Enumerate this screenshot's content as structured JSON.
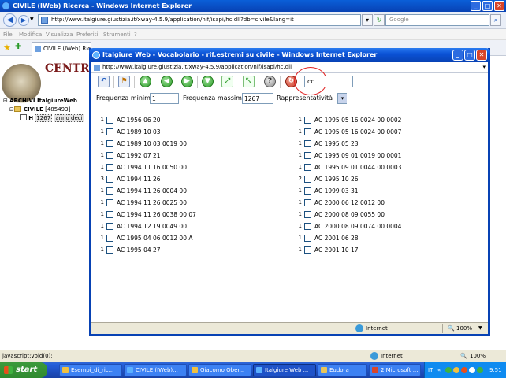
{
  "bg_window": {
    "title": "CIVILE (IWeb) Ricerca - Windows Internet Explorer",
    "url": "http://www.italgiure.giustizia.it/xway-4.5.9/application/nif/isapi/hc.dll?db=civile&lang=it",
    "search_placeholder": "Google",
    "menu": [
      "File",
      "Modifica",
      "Visualizza",
      "Preferiti",
      "Strumenti",
      "?"
    ],
    "tab_label": "CIVILE (IWeb) Ricerca",
    "header_text": "CENTRO",
    "tree": {
      "root": "ARCHIVI ItalgiureWeb",
      "civile": "CIVILE",
      "civile_count": "[485493]",
      "node_prefix": "H",
      "node_count": "1267",
      "node_label": "anno deci"
    },
    "status_left": "javascript:void(0);",
    "status_zone": "Internet",
    "zoom": "100%"
  },
  "popup": {
    "title": "Italgiure Web - Vocabolario - rif.estremi su civile - Windows Internet Explorer",
    "url": "http://www.italgiure.giustizia.it/xway-4.5.9/application/nif/isapi/hc.dll",
    "search_value": "cc",
    "filters": {
      "freq_min_label": "Frequenza minima",
      "freq_min_value": "1",
      "freq_max_label": "Frequenza massima",
      "freq_max_value": "1267",
      "rappr_label": "Rappresentatività"
    },
    "left_list": [
      {
        "count": "1",
        "text": "AC 1956 06 20"
      },
      {
        "count": "1",
        "text": "AC 1989 10 03"
      },
      {
        "count": "1",
        "text": "AC 1989 10 03 0019 00"
      },
      {
        "count": "1",
        "text": "AC 1992 07 21"
      },
      {
        "count": "1",
        "text": "AC 1994 11 16 0050 00"
      },
      {
        "count": "3",
        "text": "AC 1994 11 26"
      },
      {
        "count": "1",
        "text": "AC 1994 11 26 0004 00"
      },
      {
        "count": "1",
        "text": "AC 1994 11 26 0025 00"
      },
      {
        "count": "1",
        "text": "AC 1994 11 26 0038 00 07"
      },
      {
        "count": "1",
        "text": "AC 1994 12 19 0049 00"
      },
      {
        "count": "1",
        "text": "AC 1995 04 06 0012 00 A"
      },
      {
        "count": "1",
        "text": "AC 1995 04 27"
      }
    ],
    "right_list": [
      {
        "count": "1",
        "text": "AC 1995 05 16 0024 00 0002"
      },
      {
        "count": "1",
        "text": "AC 1995 05 16 0024 00 0007"
      },
      {
        "count": "1",
        "text": "AC 1995 05 23"
      },
      {
        "count": "1",
        "text": "AC 1995 09 01 0019 00 0001"
      },
      {
        "count": "1",
        "text": "AC 1995 09 01 0044 00 0003"
      },
      {
        "count": "2",
        "text": "AC 1995 10 26"
      },
      {
        "count": "1",
        "text": "AC 1999 03 31"
      },
      {
        "count": "1",
        "text": "AC 2000 06 12 0012 00"
      },
      {
        "count": "1",
        "text": "AC 2000 08 09 0055 00"
      },
      {
        "count": "1",
        "text": "AC 2000 08 09 0074 00 0004"
      },
      {
        "count": "1",
        "text": "AC 2001 06 28"
      },
      {
        "count": "1",
        "text": "AC 2001 10 17"
      }
    ],
    "status_zone": "Internet",
    "zoom": "100%"
  },
  "taskbar": {
    "start": "start",
    "tasks": [
      "Esempi_di_ric...",
      "CIVILE (IWeb)...",
      "Giacomo Ober...",
      "Italgiure Web ...",
      "Eudora",
      "2 Microsoft ..."
    ],
    "lang": "IT",
    "clock": "9.51"
  }
}
